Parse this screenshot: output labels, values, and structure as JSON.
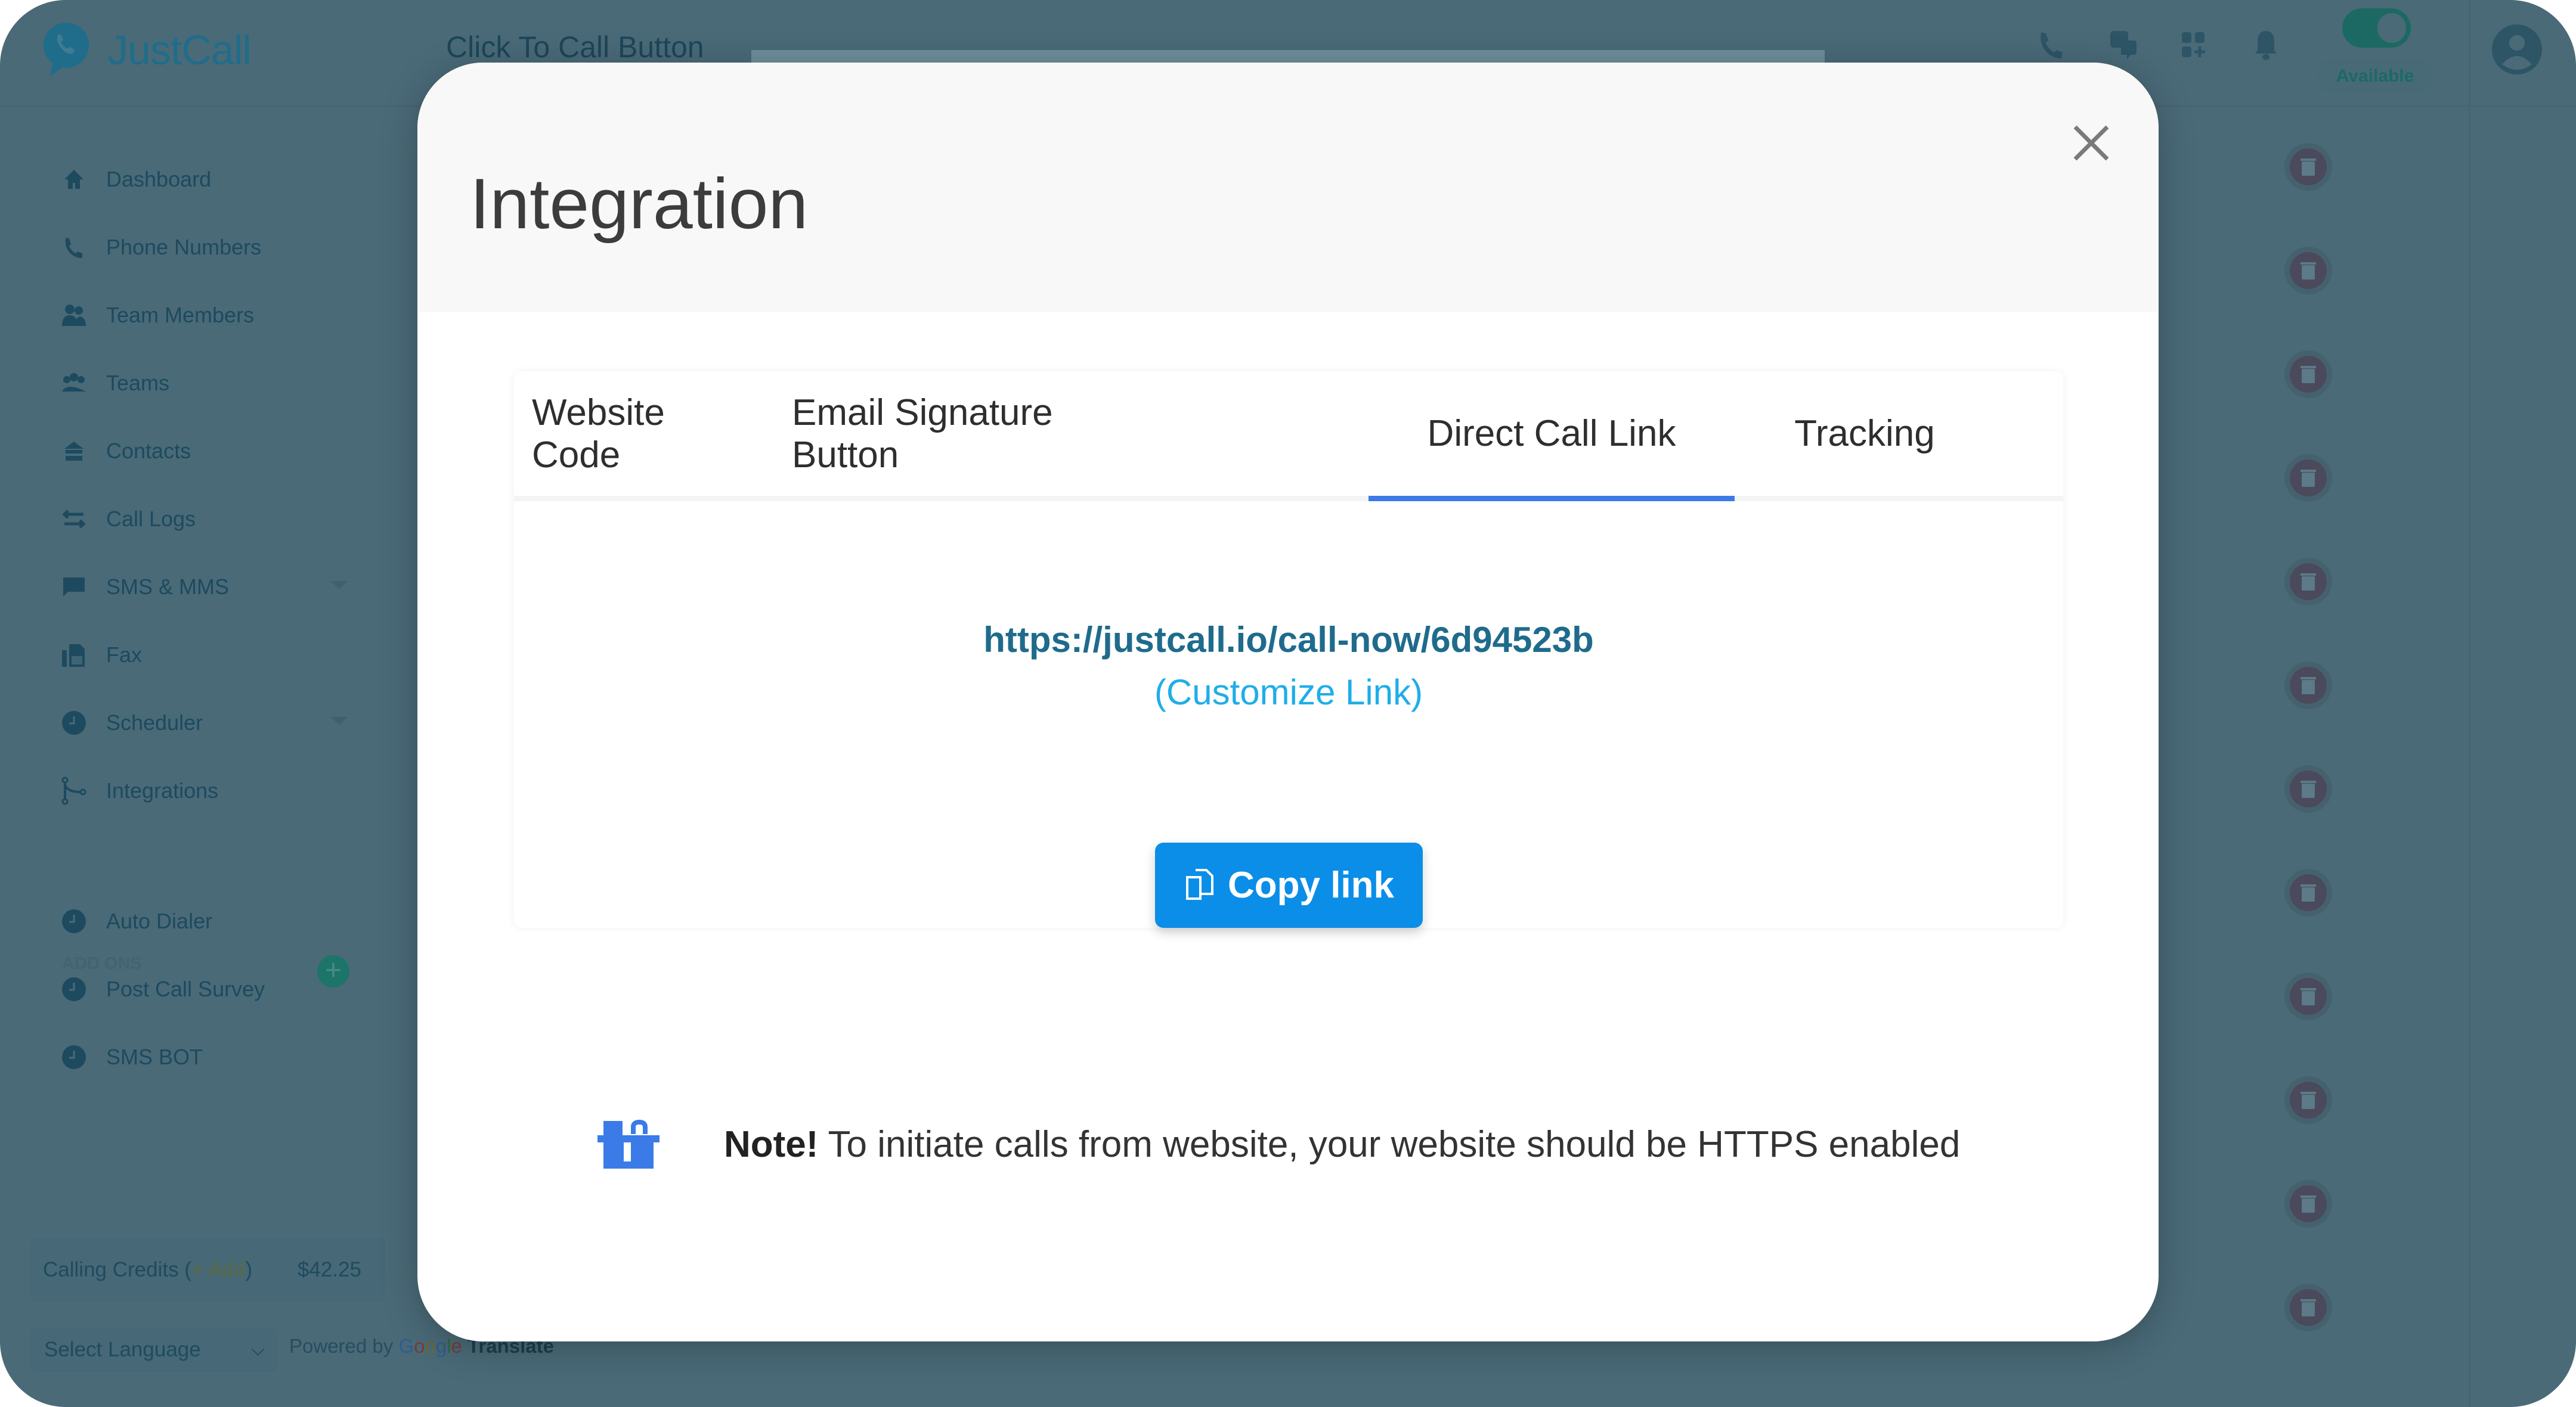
{
  "app": {
    "brand": "JustCall",
    "page_title": "Click To Call Button",
    "header_icons": [
      "phone-icon",
      "chat-icon",
      "apps-grid-icon",
      "bell-icon"
    ],
    "availability": {
      "toggle_on": true,
      "label": "Available"
    },
    "avatar": "user-avatar-icon"
  },
  "sidebar": {
    "items": [
      {
        "label": "Dashboard",
        "icon": "home-icon"
      },
      {
        "label": "Phone Numbers",
        "icon": "phone-icon"
      },
      {
        "label": "Team Members",
        "icon": "team-members-icon"
      },
      {
        "label": "Teams",
        "icon": "teams-icon"
      },
      {
        "label": "Contacts",
        "icon": "contacts-icon"
      },
      {
        "label": "Call Logs",
        "icon": "call-logs-icon"
      },
      {
        "label": "SMS & MMS",
        "icon": "sms-icon",
        "expandable": true
      },
      {
        "label": "Fax",
        "icon": "fax-icon"
      },
      {
        "label": "Scheduler",
        "icon": "clock-icon",
        "expandable": true
      },
      {
        "label": "Integrations",
        "icon": "integrations-icon"
      }
    ],
    "addons_label": "ADD ONS",
    "addons": [
      {
        "label": "Auto Dialer",
        "icon": "clock-icon"
      },
      {
        "label": "Post Call Survey",
        "icon": "clock-icon"
      },
      {
        "label": "SMS BOT",
        "icon": "clock-icon"
      }
    ],
    "credits": {
      "label": "Calling Credits (",
      "add": "+ Add",
      "close": ")",
      "amount": "$42.25"
    },
    "language": {
      "value": "Select Language"
    },
    "powered_by": {
      "prefix": "Powered by ",
      "google": [
        "G",
        "o",
        "o",
        "g",
        "l",
        "e"
      ],
      "translate": "Translate"
    }
  },
  "background": {
    "delete_buttons_count": 12
  },
  "modal": {
    "title": "Integration",
    "close_icon": "close-icon",
    "tabs": [
      {
        "label": "Website Code",
        "active": false
      },
      {
        "label": "Email Signature Button",
        "active": false
      },
      {
        "label": "Direct Call Link",
        "active": true
      },
      {
        "label": "Tracking",
        "active": false
      }
    ],
    "link": "https://justcall.io/call-now/6d94523b",
    "customize_label": "(Customize Link)",
    "copy_button": {
      "label": "Copy link",
      "icon": "copy-icon"
    },
    "note": {
      "strong": "Note!",
      "text": " To initiate calls from website, your website should be HTTPS enabled",
      "icon": "mailbox-icon"
    },
    "colors": {
      "tab_active": "#3b7ae8",
      "link": "#1f6b8c",
      "customize": "#1eaee8",
      "copy_button": "#0a8ee8"
    }
  }
}
